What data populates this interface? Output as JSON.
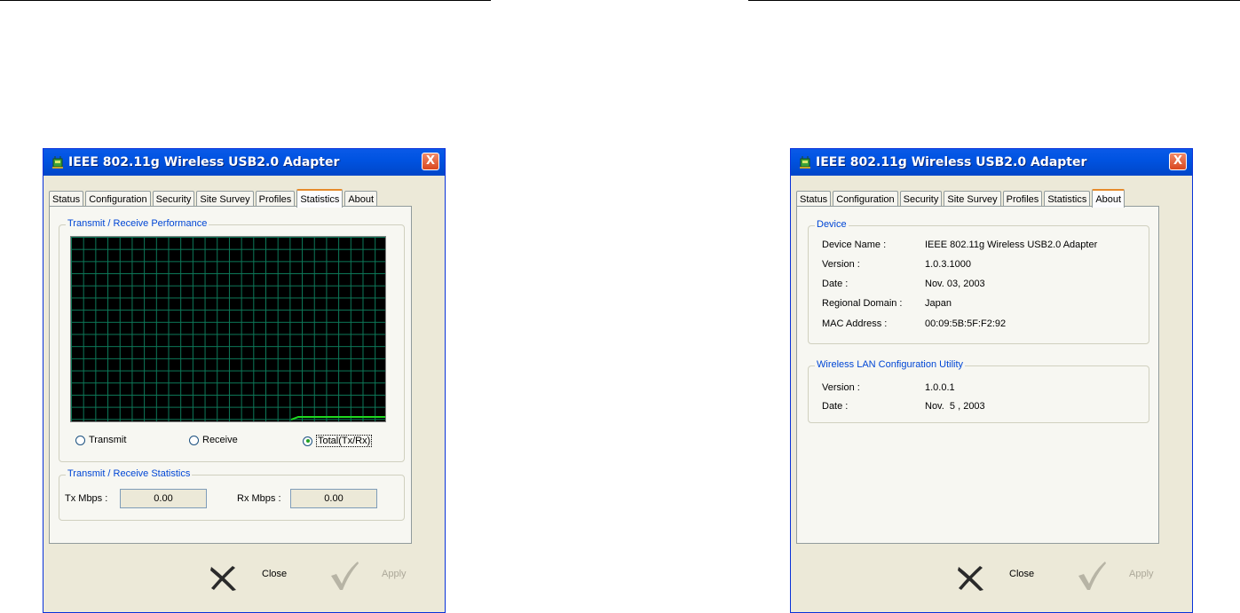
{
  "windows": {
    "stats": {
      "title": "IEEE 802.11g Wireless USB2.0 Adapter",
      "close_glyph": "X",
      "tabs": [
        "Status",
        "Configuration",
        "Security",
        "Site Survey",
        "Profiles",
        "Statistics",
        "About"
      ],
      "active_tab": "Statistics",
      "performance_group": "Transmit / Receive Performance",
      "radios": [
        {
          "label": "Transmit",
          "selected": false
        },
        {
          "label": "Receive",
          "selected": false
        },
        {
          "label": "Total(Tx/Rx)",
          "selected": true
        }
      ],
      "statistics_group": "Transmit / Receive Statistics",
      "tx_label": "Tx Mbps :",
      "tx_value": "0.00",
      "rx_label": "Rx Mbps :",
      "rx_value": "0.00",
      "close_label": "Close",
      "apply_label": "Apply"
    },
    "about": {
      "title": "IEEE 802.11g Wireless USB2.0 Adapter",
      "close_glyph": "X",
      "tabs": [
        "Status",
        "Configuration",
        "Security",
        "Site Survey",
        "Profiles",
        "Statistics",
        "About"
      ],
      "active_tab": "About",
      "device_group": "Device",
      "device_rows": [
        {
          "label": "Device Name :",
          "value": "IEEE 802.11g Wireless USB2.0 Adapter"
        },
        {
          "label": "Version :",
          "value": "1.0.3.1000"
        },
        {
          "label": "Date :",
          "value": "Nov. 03, 2003"
        },
        {
          "label": "Regional Domain :",
          "value": "Japan"
        },
        {
          "label": "MAC Address :",
          "value": "00:09:5B:5F:F2:92"
        }
      ],
      "utility_group": "Wireless LAN Configuration Utility",
      "utility_rows": [
        {
          "label": "Version :",
          "value": "1.0.0.1"
        },
        {
          "label": "Date :",
          "value": "Nov.  5 , 2003"
        }
      ],
      "close_label": "Close",
      "apply_label": "Apply"
    }
  },
  "colors": {
    "titlebar": "#0053e1",
    "active_tab_highlight": "#e68b2c",
    "group_label": "#0046d5",
    "graph_background": "#000000",
    "graph_grid": "#0d7a5a",
    "graph_line": "#1fd91f"
  },
  "icons": {
    "app": "wireless-adapter-icon",
    "close_action": "x-cross-icon",
    "apply_action": "checkmark-icon"
  }
}
